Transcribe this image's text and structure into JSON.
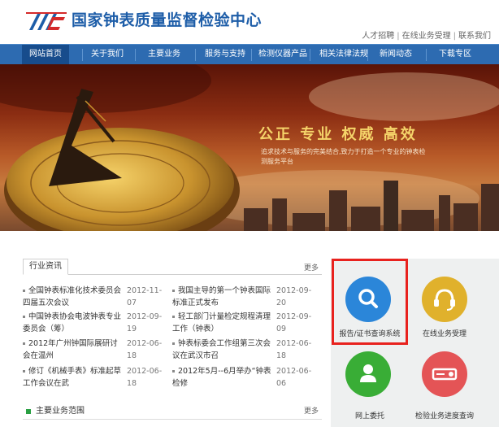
{
  "header": {
    "site_title": "国家钟表质量监督检验中心",
    "top_links": [
      "人才招聘",
      "在线业务受理",
      "联系我们"
    ],
    "separator": "|"
  },
  "nav": {
    "items": [
      "网站首页",
      "关于我们",
      "主要业务",
      "服务与支持",
      "检测仪器产品",
      "相关法律法规",
      "新闻动态",
      "下载专区"
    ],
    "active_index": 0
  },
  "banner": {
    "slogan": "公正  专业  权威  高效",
    "description": "追求技术与服务的完美结合,致力于打造一个专业的钟表检测服务平台"
  },
  "news": {
    "tab_label": "行业资讯",
    "more_label": "更多",
    "left_items": [
      {
        "title": "全国钟表标准化技术委员会四届五次会议",
        "date": "2012-11-07"
      },
      {
        "title": "中国钟表协会电波钟表专业委员会（筹）",
        "date": "2012-09-19"
      },
      {
        "title": "2012年广州钟国际展研讨会在温州",
        "date": "2012-06-18"
      },
      {
        "title": "修订《机械手表》标准起草工作会议在武",
        "date": "2012-06-18"
      }
    ],
    "right_items": [
      {
        "title": "我国主导的第一个钟表国际标准正式发布",
        "date": "2012-09-20"
      },
      {
        "title": "轻工部门计量检定规程清理工作（钟表）",
        "date": "2012-09-09"
      },
      {
        "title": "钟表标委会工作组第三次会议在武汉市召",
        "date": "2012-06-18"
      },
      {
        "title": "2012年5月--6月举办“钟表检修",
        "date": "2012-06-06"
      }
    ]
  },
  "business": {
    "title": "主要业务范围",
    "more_label": "更多"
  },
  "services": [
    {
      "label": "报告/证书查询系统",
      "icon": "search-icon",
      "color": "#2b86d9"
    },
    {
      "label": "在线业务受理",
      "icon": "headset-icon",
      "color": "#e0b12c"
    },
    {
      "label": "网上委托",
      "icon": "user-icon",
      "color": "#39ad36"
    },
    {
      "label": "检验业务进度查询",
      "icon": "projector-icon",
      "color": "#e45456"
    }
  ],
  "colors": {
    "brand_blue": "#1d5da8",
    "nav_bg": "#2d6bb1",
    "nav_active": "#174c8c",
    "highlight_red": "#e8221e"
  }
}
